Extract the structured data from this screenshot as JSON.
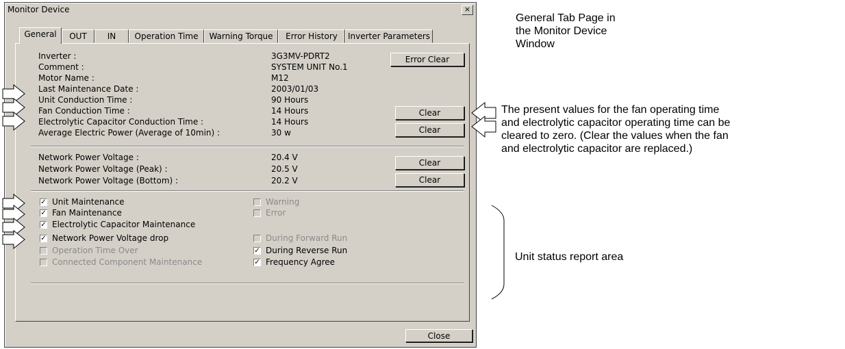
{
  "window": {
    "title": "Monitor Device",
    "close_glyph": "×"
  },
  "tabs": [
    "General",
    "OUT",
    "IN",
    "Operation Time",
    "Warning Torque",
    "Error History",
    "Inverter Parameters"
  ],
  "info_rows": [
    {
      "label": "Inverter :",
      "value": "3G3MV-PDRT2"
    },
    {
      "label": "Comment :",
      "value": "SYSTEM UNIT No.1"
    },
    {
      "label": "Motor Name :",
      "value": "M12"
    },
    {
      "label": "Last Maintenance Date :",
      "value": "2003/01/03"
    },
    {
      "label": "Unit Conduction Time :",
      "value": "90 Hours"
    },
    {
      "label": "Fan Conduction Time :",
      "value": "14 Hours"
    },
    {
      "label": "Electrolytic Capacitor Conduction Time :",
      "value": "14 Hours"
    },
    {
      "label": "Average Electric Power (Average of 10min) :",
      "value": "30 w"
    }
  ],
  "voltage_rows": [
    {
      "label": "Network Power Voltage :",
      "value": "20.4 V"
    },
    {
      "label": "Network Power Voltage (Peak) :",
      "value": "20.5 V"
    },
    {
      "label": "Network Power Voltage (Bottom) :",
      "value": "20.2 V"
    }
  ],
  "buttons": {
    "error_clear": "Error Clear",
    "clear": "Clear",
    "close": "Close"
  },
  "status_left": [
    {
      "label": "Unit Maintenance",
      "checked": true,
      "enabled": true
    },
    {
      "label": "Fan Maintenance",
      "checked": true,
      "enabled": true
    },
    {
      "label": "Electrolytic Capacitor Maintenance",
      "checked": true,
      "enabled": true
    },
    {
      "label": "Network Power Voltage drop",
      "checked": true,
      "enabled": true
    },
    {
      "label": "Operation Time Over",
      "checked": false,
      "enabled": false
    },
    {
      "label": "Connected Component Maintenance",
      "checked": false,
      "enabled": false
    }
  ],
  "status_right": [
    {
      "label": "Warning",
      "checked": false,
      "enabled": false
    },
    {
      "label": "Error",
      "checked": false,
      "enabled": false
    },
    {
      "label": "During Forward Run",
      "checked": false,
      "enabled": false
    },
    {
      "label": "During Reverse Run",
      "checked": true,
      "enabled": true
    },
    {
      "label": "Frequency Agree",
      "checked": true,
      "enabled": true
    }
  ],
  "annotations": {
    "title_lines": [
      "General Tab Page in",
      "the Monitor Device",
      "Window"
    ],
    "clear_note_lines": [
      "The present values for the fan operating time",
      "and electrolytic capacitor operating time can be",
      "cleared to zero. (Clear the values when the fan",
      "and electrolytic capacitor are replaced.)"
    ],
    "status_area": "Unit status report area"
  },
  "check_glyph": "✓"
}
